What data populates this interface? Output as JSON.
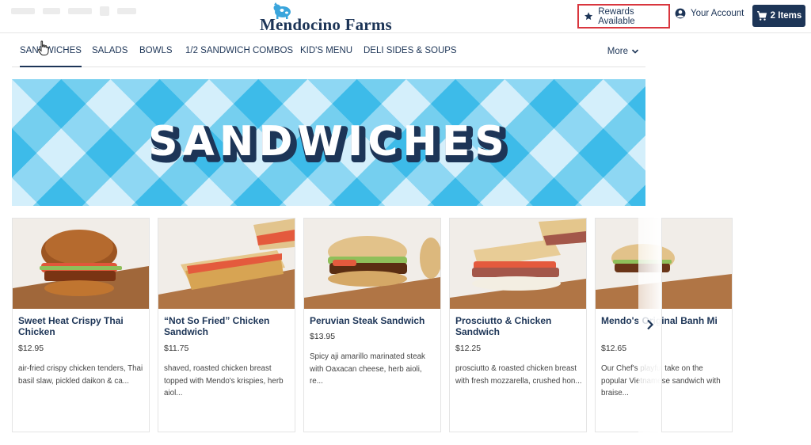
{
  "header": {
    "brand": "Mendocino Farms",
    "rewards_label": "Rewards Available",
    "account_label": "Your Account",
    "cart_label": "2 Items"
  },
  "nav": {
    "categories": [
      "SANDWICHES",
      "SALADS",
      "BOWLS",
      "1/2 SANDWICH COMBOS",
      "KID'S MENU",
      "DELI SIDES & SOUPS"
    ],
    "active_index": 0,
    "more_label": "More"
  },
  "banner": {
    "title": "SANDWICHES"
  },
  "products": [
    {
      "name": "Sweet Heat Crispy Thai Chicken",
      "price": "$12.95",
      "description": "air-fried crispy chicken tenders, Thai basil slaw, pickled daikon & ca..."
    },
    {
      "name": "“Not So Fried” Chicken Sandwich",
      "price": "$11.75",
      "description": "shaved, roasted chicken breast topped with Mendo's krispies, herb aiol..."
    },
    {
      "name": "Peruvian Steak Sandwich",
      "price": "$13.95",
      "description": "Spicy aji amarillo marinated steak with Oaxacan cheese, herb aioli, re..."
    },
    {
      "name": "Prosciutto & Chicken Sandwich",
      "price": "$12.25",
      "description": "prosciutto & roasted chicken breast with fresh mozzarella, crushed hon..."
    },
    {
      "name": "Mendo's Original Banh Mi",
      "price": "$12.65",
      "description": "Our Chef's playful take on the popular Vietnamese sandwich with braise..."
    }
  ],
  "colors": {
    "navy": "#1d3557",
    "banner_blue": "#3dbbe9",
    "rewards_border": "#d9363e"
  }
}
